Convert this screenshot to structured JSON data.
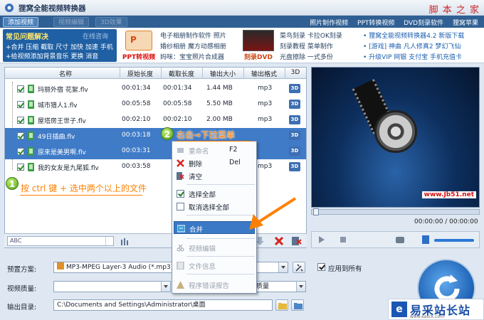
{
  "window": {
    "title": "狸窝全能视频转换器",
    "watermark": "脚 本 之 家"
  },
  "tabs": [
    {
      "label": "添加视频",
      "active": true
    },
    {
      "label": "视频编辑",
      "active": false
    },
    {
      "label": "3D效果",
      "active": false
    }
  ],
  "toplinks": [
    "照片制作视频",
    "PPT转换视频",
    "DVD刻录软件",
    "狸窝苹果"
  ],
  "ads": {
    "faq_title": "常见问题解决",
    "faq_online": "在线咨询",
    "faq_line1": "+合并 压缩 截取 尺寸 加快 加速 手机",
    "faq_line2": "+给视频添加背景音乐 更换 消音",
    "ppt_caption": "PPT转视频",
    "col1": [
      "电子相册制作软件 照片",
      "婚纱相册 魔方动感相册",
      "妈咪：宝宝照片合成器"
    ],
    "dvd_caption": "刻录DVD",
    "col2": [
      "菜鸟刻录 卡拉OK刻录",
      "刻录教程 菜单制作",
      "光盘擦除 一式多份"
    ],
    "col3": [
      "• 狸窝全能视频转换器4.2 新版下载",
      "• [游戏] 神曲 凡人修真2 梦幻飞仙",
      "• 升级VIP 网银 支付宝 手机充值卡"
    ]
  },
  "table": {
    "headers": [
      "名称",
      "原始长度",
      "截取长度",
      "输出大小",
      "输出格式",
      "3D"
    ],
    "rows": [
      {
        "name": "玛丽外宿 花絮.flv",
        "orig": "00:01:34",
        "cut": "00:01:34",
        "size": "1.44 MB",
        "fmt": "mp3",
        "selected": false
      },
      {
        "name": "城市猎人1.flv",
        "orig": "00:05:58",
        "cut": "00:05:58",
        "size": "5.50 MB",
        "fmt": "mp3",
        "selected": false
      },
      {
        "name": "屋塔房王世子.flv",
        "orig": "00:02:10",
        "cut": "00:02:10",
        "size": "2.00 MB",
        "fmt": "mp3",
        "selected": false
      },
      {
        "name": "49日插曲.flv",
        "orig": "00:03:18",
        "cut": "",
        "size": "",
        "fmt": "",
        "selected": true
      },
      {
        "name": "原来是美男啊.flv",
        "orig": "00:03:31",
        "cut": "",
        "size": "",
        "fmt": "",
        "selected": true
      },
      {
        "name": "我的女友是九尾狐.flv",
        "orig": "00:03:58",
        "cut": "",
        "size": "",
        "fmt": "mp3",
        "selected": false
      }
    ],
    "cell_3d": "3D"
  },
  "toolbar": {
    "abc": "ABC"
  },
  "context_menu": {
    "items": [
      {
        "label": "重命名",
        "shortcut": "F2",
        "disabled": true
      },
      {
        "label": "删除",
        "shortcut": "Del",
        "disabled": false
      },
      {
        "label": "清空",
        "shortcut": "",
        "disabled": false
      },
      {
        "label": "选择全部",
        "shortcut": "",
        "disabled": false
      },
      {
        "label": "取消选择全部",
        "shortcut": "",
        "disabled": false
      },
      {
        "label": "合并",
        "shortcut": "",
        "disabled": false,
        "highlighted": true
      },
      {
        "label": "视频编辑",
        "shortcut": "",
        "disabled": true
      },
      {
        "label": "文件信息",
        "shortcut": "",
        "disabled": true
      },
      {
        "label": "程序错误报告",
        "shortcut": "",
        "disabled": true
      }
    ]
  },
  "annotations": {
    "step1_badge": "1",
    "step1_text": "按 ctrl 键 + 选中两个以上的文件",
    "step2_badge": "2",
    "step2_text": "右击→下拉菜单"
  },
  "preview": {
    "watermark": "www.Jb51.net",
    "timecode": "00:00:00 / 00:00:00",
    "progress": 0
  },
  "settings": {
    "preset_label": "预置方案:",
    "preset_value": "MP3-MPEG Layer-3 Audio (*.mp3)",
    "quality_label": "视频质量:",
    "audio_quality_value": "质量",
    "apply_all_label": "应用到所有",
    "output_label": "输出目录:",
    "output_value": "C:\\Documents and Settings\\Administrator\\桌面"
  },
  "brand": {
    "name": "易采站长站",
    "url": "www.easck.com"
  },
  "colors": {
    "accent": "#2f5f93",
    "selection": "#3f7bc7",
    "annotation": "#ff8000"
  }
}
